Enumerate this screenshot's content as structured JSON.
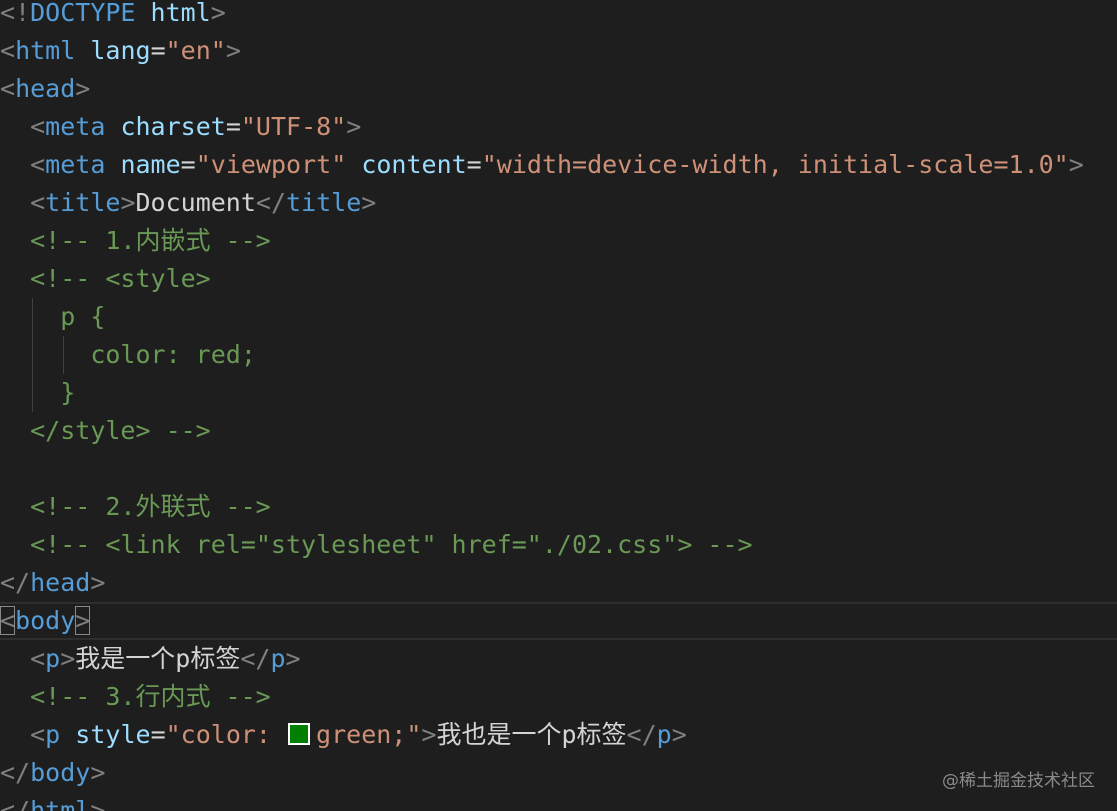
{
  "code": {
    "l1": {
      "open": "<!",
      "kw": "DOCTYPE",
      "sp": " ",
      "name": "html",
      "close": ">"
    },
    "l2": {
      "open": "<",
      "tag": "html",
      "sp": " ",
      "attr": "lang",
      "eq": "=",
      "val": "\"en\"",
      "close": ">"
    },
    "l3": {
      "open": "<",
      "tag": "head",
      "close": ">"
    },
    "l4": {
      "indent": "  ",
      "open": "<",
      "tag": "meta",
      "sp": " ",
      "attr": "charset",
      "eq": "=",
      "val": "\"UTF-8\"",
      "close": ">"
    },
    "l5": {
      "indent": "  ",
      "open": "<",
      "tag": "meta",
      "sp1": " ",
      "attr1": "name",
      "eq1": "=",
      "val1": "\"viewport\"",
      "sp2": " ",
      "attr2": "content",
      "eq2": "=",
      "val2": "\"width=device-width, initial-scale=1.0\"",
      "close": ">"
    },
    "l6": {
      "indent": "  ",
      "open": "<",
      "tag": "title",
      "close": ">",
      "text": "Document",
      "open2": "</",
      "tag2": "title",
      "close2": ">"
    },
    "l7": {
      "indent": "  ",
      "comment": "<!-- 1.内嵌式 -->"
    },
    "l8": {
      "indent": "  ",
      "comment": "<!-- <style>"
    },
    "l9": {
      "indent": "    ",
      "comment": "p {"
    },
    "l10": {
      "indent": "      ",
      "comment": "color: red;"
    },
    "l11": {
      "indent": "    ",
      "comment": "}"
    },
    "l12": {
      "indent": "  ",
      "comment": "</style> -->"
    },
    "l13": {
      "text": ""
    },
    "l14": {
      "indent": "  ",
      "comment": "<!-- 2.外联式 -->"
    },
    "l15": {
      "indent": "  ",
      "comment": "<!-- <link rel=\"stylesheet\" href=\"./02.css\"> -->"
    },
    "l16": {
      "open": "</",
      "tag": "head",
      "close": ">"
    },
    "l17": {
      "open": "<",
      "tag": "body",
      "close": ">"
    },
    "l18": {
      "indent": "  ",
      "open": "<",
      "tag": "p",
      "close": ">",
      "text": "我是一个p标签",
      "open2": "</",
      "tag2": "p",
      "close2": ">"
    },
    "l19": {
      "indent": "  ",
      "comment": "<!-- 3.行内式 -->"
    },
    "l20": {
      "indent": "  ",
      "open": "<",
      "tag": "p",
      "sp": " ",
      "attr": "style",
      "eq": "=",
      "val_a": "\"color: ",
      "val_b": "green;\"",
      "close": ">",
      "text": "我也是一个p标签",
      "open2": "</",
      "tag2": "p",
      "close2": ">"
    },
    "l21": {
      "open": "</",
      "tag": "body",
      "close": ">"
    },
    "l22": {
      "open": "</",
      "tag": "html",
      "close": ">"
    }
  },
  "swatch_color": "#008000",
  "watermark": "@稀土掘金技术社区",
  "colors": {
    "background": "#1e1e1e",
    "tag": "#569cd6",
    "attribute": "#9cdcfe",
    "string": "#ce9178",
    "comment": "#6a9955",
    "punctuation": "#808080",
    "text": "#d4d4d4"
  }
}
